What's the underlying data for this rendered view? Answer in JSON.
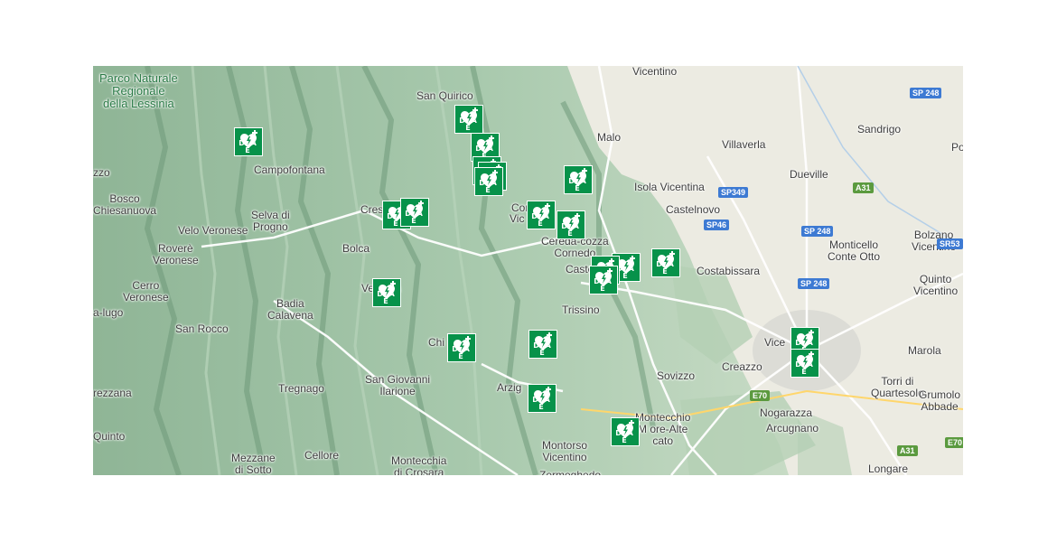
{
  "map": {
    "colors": {
      "terrain": "#9fc3a5",
      "plain": "#ecebe2",
      "marker": "#07924a",
      "road_blue": "#3d7ad3",
      "road_green": "#5b9a3f"
    },
    "marker_icon": "defibrillator-aed-icon",
    "marker_text": "D A E",
    "labels": [
      {
        "id": "parco",
        "text": "Parco Naturale Regionale della Lessinia",
        "lines": [
          "Parco Naturale",
          "Regionale",
          "della Lessinia"
        ],
        "kind": "park"
      },
      {
        "id": "vicentino",
        "text": "Vicentino"
      },
      {
        "id": "san-quirico",
        "text": "San Quirico"
      },
      {
        "id": "malo",
        "text": "Malo"
      },
      {
        "id": "villaverla",
        "text": "Villaverla"
      },
      {
        "id": "sandrigo",
        "text": "Sandrigo"
      },
      {
        "id": "po",
        "text": "Po"
      },
      {
        "id": "zzo",
        "text": "zzo"
      },
      {
        "id": "campofontana",
        "text": "Campofontana"
      },
      {
        "id": "dueville",
        "text": "Dueville"
      },
      {
        "id": "isola-vicentina",
        "text": "Isola Vicentina"
      },
      {
        "id": "bosco-chiesanuova",
        "text": "Bosco Chiesanuova",
        "lines": [
          "Bosco",
          "Chiesanuova"
        ]
      },
      {
        "id": "velo-veronese",
        "text": "Velo Veronese"
      },
      {
        "id": "selva-di-progno",
        "text": "Selva di Progno",
        "lines": [
          "Selva di",
          "Progno"
        ]
      },
      {
        "id": "cres",
        "text": "Cres"
      },
      {
        "id": "cor",
        "text": "Cor"
      },
      {
        "id": "vic",
        "text": "Vic"
      },
      {
        "id": "castelnovo",
        "text": "Castelnovo"
      },
      {
        "id": "bolca",
        "text": "Bolca"
      },
      {
        "id": "cereda",
        "text": "Cereda-cozza Cornedo",
        "lines": [
          "Cereda-cozza",
          "Cornedo"
        ]
      },
      {
        "id": "bolzano",
        "text": "Bolzano Vicentino",
        "lines": [
          "Bolzano",
          "Vicentino"
        ]
      },
      {
        "id": "monticello",
        "text": "Monticello Conte Otto",
        "lines": [
          "Monticello",
          "Conte Otto"
        ]
      },
      {
        "id": "rovere",
        "text": "Roverè Veronese",
        "lines": [
          "Roverè",
          "Veronese"
        ]
      },
      {
        "id": "castel",
        "text": "Castel"
      },
      {
        "id": "costabissara",
        "text": "Costabissara"
      },
      {
        "id": "quinto-vicentino",
        "text": "Quinto Vicentino",
        "lines": [
          "Quinto",
          "Vicentino"
        ]
      },
      {
        "id": "cerro",
        "text": "Cerro Veronese",
        "lines": [
          "Cerro",
          "Veronese"
        ]
      },
      {
        "id": "vestenanova",
        "text": "Ve nova"
      },
      {
        "id": "badia",
        "text": "Badia Calavena",
        "lines": [
          "Badia",
          "Calavena"
        ]
      },
      {
        "id": "a-lugo",
        "text": "a-lugo"
      },
      {
        "id": "trissino",
        "text": "Trissino"
      },
      {
        "id": "san-rocco",
        "text": "San Rocco"
      },
      {
        "id": "chi",
        "text": "Chi"
      },
      {
        "id": "vice",
        "text": "Vice"
      },
      {
        "id": "marola",
        "text": "Marola"
      },
      {
        "id": "sovizzo",
        "text": "Sovizzo"
      },
      {
        "id": "creazzo",
        "text": "Creazzo"
      },
      {
        "id": "torri",
        "text": "Torri di Quartesolo",
        "lines": [
          "Torri di",
          "Quartesolo"
        ]
      },
      {
        "id": "san-giovanni",
        "text": "San Giovanni Ilarione",
        "lines": [
          "San Giovanni",
          "Ilarione"
        ]
      },
      {
        "id": "tregnago",
        "text": "Tregnago"
      },
      {
        "id": "arzig",
        "text": "Arzig"
      },
      {
        "id": "rezzana",
        "text": "rezzana"
      },
      {
        "id": "grumolo",
        "text": "Grumolo Abbade",
        "lines": [
          "Grumolo",
          "Abbade"
        ]
      },
      {
        "id": "nogarazza",
        "text": "Nogarazza"
      },
      {
        "id": "montecchio",
        "text": "Montecchio Maggiore-Alte Ceccato",
        "lines": [
          "Montecchio",
          "M     ore-Alte",
          "     cato"
        ]
      },
      {
        "id": "arcugnano",
        "text": "Arcugnano"
      },
      {
        "id": "quinto",
        "text": "Quinto"
      },
      {
        "id": "montorso",
        "text": "Montorso Vicentino",
        "lines": [
          "Montorso",
          "Vicentino"
        ]
      },
      {
        "id": "mezzane",
        "text": "Mezzane di Sotto",
        "lines": [
          "Mezzane",
          "di Sotto"
        ]
      },
      {
        "id": "cellore",
        "text": "Cellore"
      },
      {
        "id": "montecchia",
        "text": "Montecchia di Crosara",
        "lines": [
          "Montecchia",
          "di Crosara"
        ]
      },
      {
        "id": "zermeghedo",
        "text": "Zermeghedo"
      },
      {
        "id": "longare",
        "text": "Longare"
      }
    ],
    "road_shields": [
      {
        "id": "sp248-a",
        "text": "SP 248",
        "color": "blue"
      },
      {
        "id": "sp349",
        "text": "SP349",
        "color": "blue"
      },
      {
        "id": "sp46",
        "text": "SP46",
        "color": "blue"
      },
      {
        "id": "a31-a",
        "text": "A31",
        "color": "green"
      },
      {
        "id": "sp248-b",
        "text": "SP 248",
        "color": "blue"
      },
      {
        "id": "sr53",
        "text": "SR53",
        "color": "blue"
      },
      {
        "id": "sp248-c",
        "text": "SP 248",
        "color": "blue"
      },
      {
        "id": "e70-a",
        "text": "E70",
        "color": "green"
      },
      {
        "id": "a31-b",
        "text": "A31",
        "color": "green"
      },
      {
        "id": "e70-b",
        "text": "E70",
        "color": "green"
      }
    ],
    "markers_count": 22
  }
}
